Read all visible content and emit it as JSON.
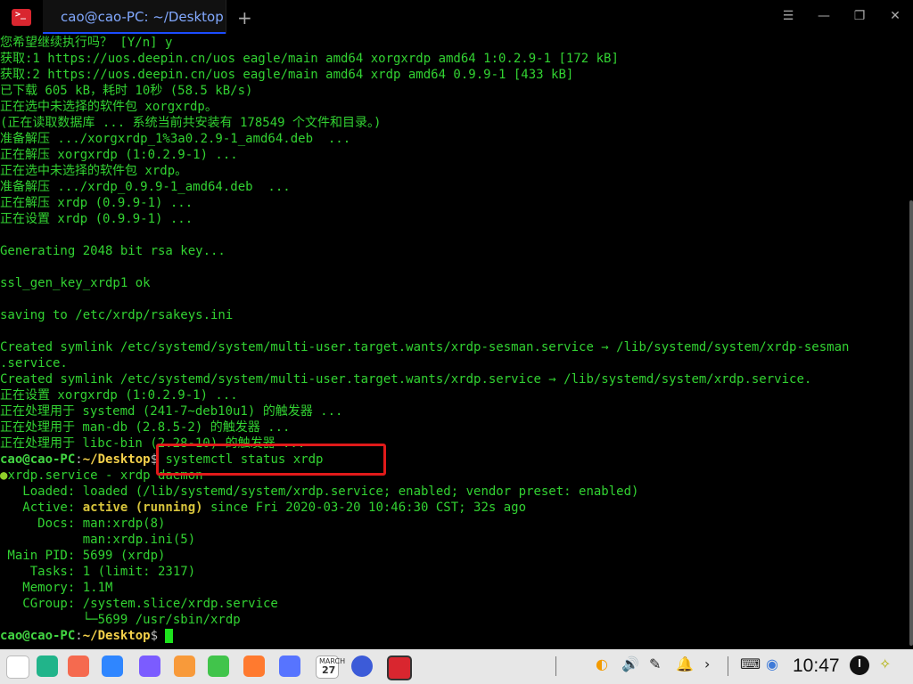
{
  "window": {
    "tab_title": "cao@cao-PC: ~/Desktop",
    "new_tab_icon": "plus-icon",
    "buttons": [
      "menu-icon",
      "minimize-icon",
      "restore-icon",
      "close-icon"
    ]
  },
  "terminal": {
    "lines": [
      "您希望继续执行吗？ [Y/n] y",
      "获取:1 https://uos.deepin.cn/uos eagle/main amd64 xorgxrdp amd64 1:0.2.9-1 [172 kB]",
      "获取:2 https://uos.deepin.cn/uos eagle/main amd64 xrdp amd64 0.9.9-1 [433 kB]",
      "已下载 605 kB，耗时 10秒 (58.5 kB/s)",
      "正在选中未选择的软件包 xorgxrdp。",
      "(正在读取数据库 ... 系统当前共安装有 178549 个文件和目录。)",
      "准备解压 .../xorgxrdp_1%3a0.2.9-1_amd64.deb  ...",
      "正在解压 xorgxrdp (1:0.2.9-1) ...",
      "正在选中未选择的软件包 xrdp。",
      "准备解压 .../xrdp_0.9.9-1_amd64.deb  ...",
      "正在解压 xrdp (0.9.9-1) ...",
      "正在设置 xrdp (0.9.9-1) ...",
      "",
      "Generating 2048 bit rsa key...",
      "",
      "ssl_gen_key_xrdp1 ok",
      "",
      "saving to /etc/xrdp/rsakeys.ini",
      "",
      "Created symlink /etc/systemd/system/multi-user.target.wants/xrdp-sesman.service → /lib/systemd/system/xrdp-sesman",
      ".service.",
      "Created symlink /etc/systemd/system/multi-user.target.wants/xrdp.service → /lib/systemd/system/xrdp.service.",
      "正在设置 xorgxrdp (1:0.2.9-1) ...",
      "正在处理用于 systemd (241-7~deb10u1) 的触发器 ...",
      "正在处理用于 man-db (2.8.5-2) 的触发器 ...",
      "正在处理用于 libc-bin (2.28-10) 的触发器 ..."
    ],
    "prompt_user": "cao@cao-PC",
    "prompt_sep": ":",
    "prompt_path": "~/Desktop",
    "prompt_dollar": "$",
    "command": " systemctl status xrdp",
    "status": {
      "service": "xrdp.service - xrdp daemon",
      "loaded": "   Loaded: loaded (/lib/systemd/system/xrdp.service; enabled; vendor preset: enabled)",
      "active_label": "   Active: ",
      "active_state": "active (running)",
      "active_since": " since Fri 2020-03-20 10:46:30 CST; 32s ago",
      "docs1": "     Docs: man:xrdp(8)",
      "docs2": "           man:xrdp.ini(5)",
      "pid": " Main PID: 5699 (xrdp)",
      "tasks": "    Tasks: 1 (limit: 2317)",
      "memory": "   Memory: 1.1M",
      "cgroup": "   CGroup: /system.slice/xrdp.service",
      "cgroup_child": "           └─5699 /usr/sbin/xrdp"
    }
  },
  "dock": {
    "calendar_month": "MARCH",
    "calendar_day": "27",
    "clock": "10:47",
    "colors": {
      "launcher": "#6e6eff",
      "multitask": "#21b48a",
      "appstore": "#f56a4f",
      "files": "#2f86ff",
      "browser": "#7b5cff",
      "photos": "#f89a3a",
      "music": "#41c44b",
      "shop": "#ff7a2f",
      "docs": "#5774ff",
      "settings": "#3c5bd8",
      "terminal": "#d9262f"
    }
  }
}
